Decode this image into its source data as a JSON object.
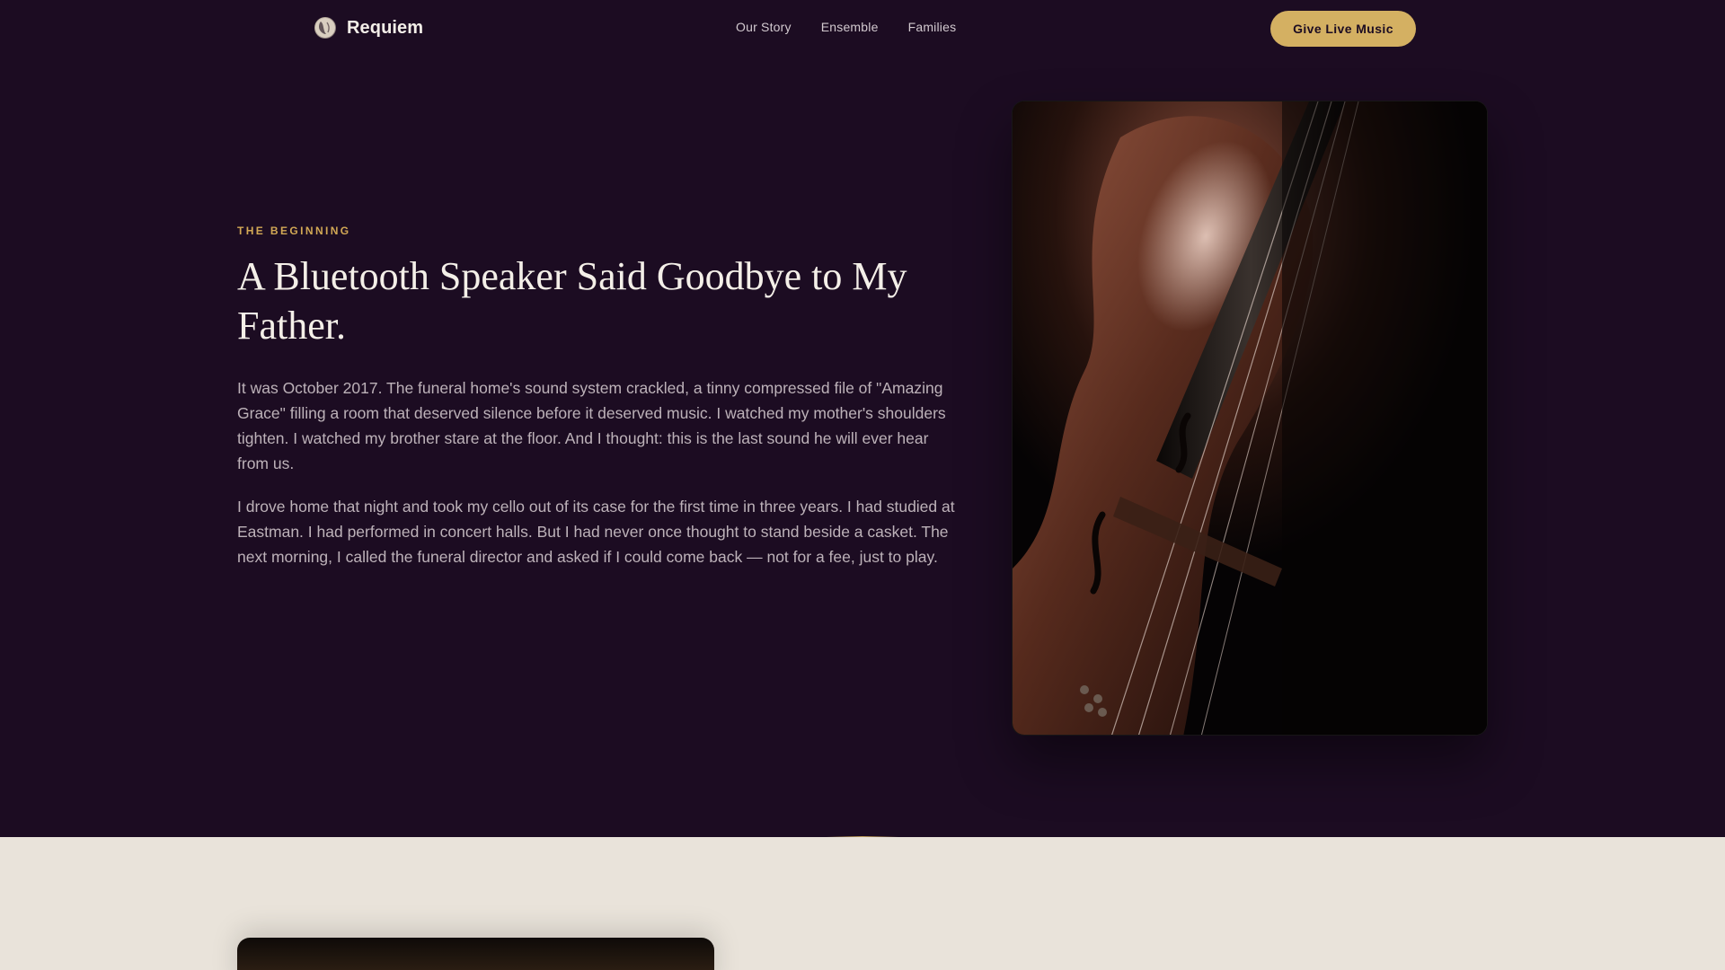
{
  "brand": {
    "name": "Requiem",
    "logo_icon": "moon-icon"
  },
  "nav": {
    "links": [
      "Our Story",
      "Ensemble",
      "Families"
    ],
    "cta_label": "Give Live Music"
  },
  "hero": {
    "eyebrow": "THE BEGINNING",
    "headline": "A Bluetooth Speaker Said Goodbye to My Father.",
    "paragraphs": [
      "It was October 2017. The funeral home's sound system crackled, a tinny compressed file of \"Amazing Grace\" filling a room that deserved silence before it deserved music. I watched my mother's shoulders tighten. I watched my brother stare at the floor. And I thought: this is the last sound he will ever hear from us.",
      "I drove home that night and took my cello out of its case for the first time in three years. I had studied at Eastman. I had performed in concert halls. But I had never once thought to stand beside a casket. The next morning, I called the funeral director and asked if I could come back — not for a fee, just to play."
    ],
    "image": "cello-photo"
  },
  "colors": {
    "background": "#1c0c22",
    "accent": "#d4b062",
    "eyebrow": "#d2a855",
    "lower_background": "#e9e3da"
  }
}
